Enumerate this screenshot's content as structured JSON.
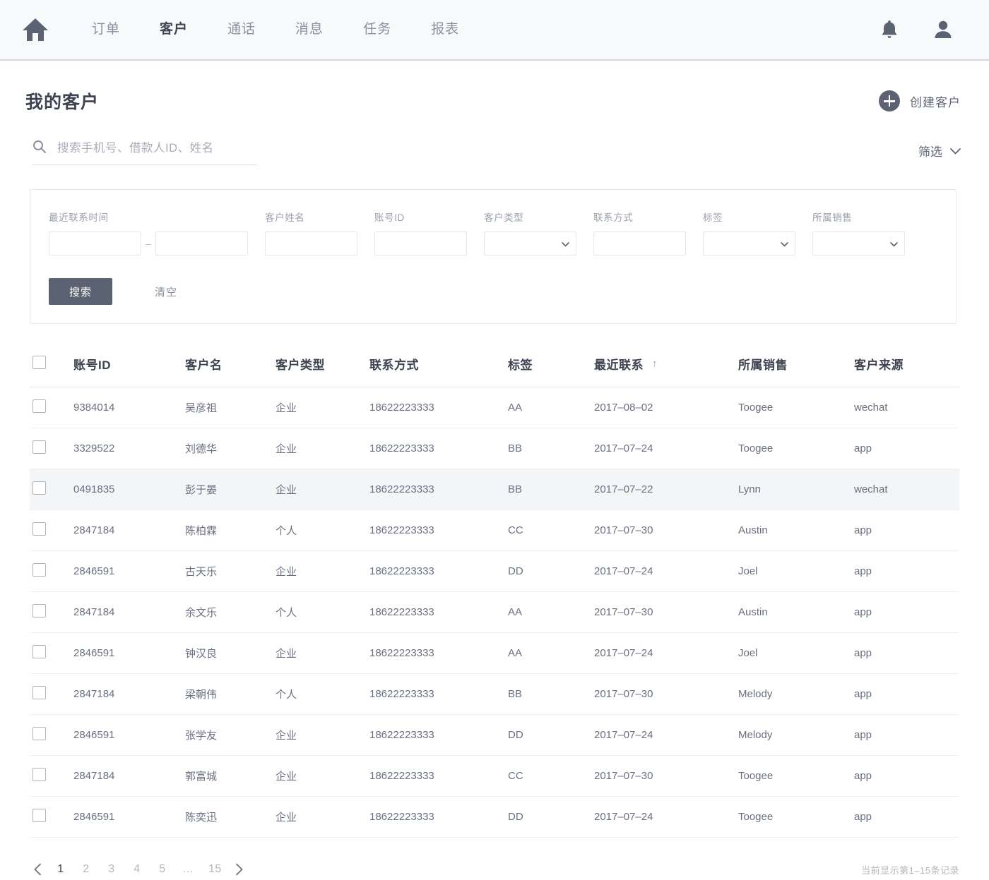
{
  "nav": {
    "home_icon": "home-icon",
    "links": [
      {
        "label": "订单",
        "active": false
      },
      {
        "label": "客户",
        "active": true
      },
      {
        "label": "通话",
        "active": false
      },
      {
        "label": "消息",
        "active": false
      },
      {
        "label": "任务",
        "active": false
      },
      {
        "label": "报表",
        "active": false
      }
    ],
    "bell_icon": "bell-icon",
    "avatar_icon": "user-avatar-icon"
  },
  "header": {
    "title": "我的客户",
    "create_label": "创建客户",
    "create_icon": "plus-circle-icon"
  },
  "search": {
    "icon": "search-icon",
    "value": "",
    "placeholder": "搜索手机号、借款人ID、姓名",
    "filter_toggle_label": "筛选",
    "filter_toggle_icon": "chevron-down-icon"
  },
  "filters": {
    "date_range": {
      "label": "最近联系时间",
      "from": "",
      "to": "",
      "separator": "–"
    },
    "customer_name": {
      "label": "客户姓名",
      "value": ""
    },
    "account_id": {
      "label": "账号ID",
      "value": ""
    },
    "customer_type": {
      "label": "客户类型",
      "value": ""
    },
    "contact": {
      "label": "联系方式",
      "value": ""
    },
    "tag": {
      "label": "标签",
      "value": ""
    },
    "sales_owner": {
      "label": "所属销售",
      "value": ""
    },
    "search_button": "搜索",
    "clear_button": "清空"
  },
  "table": {
    "columns": [
      "账号ID",
      "客户名",
      "客户类型",
      "联系方式",
      "标签",
      "最近联系",
      "所属销售",
      "客户来源"
    ],
    "sort_column": "最近联系",
    "sort_arrow": "↑",
    "rows": [
      {
        "account_id": "9384014",
        "name": "吴彦祖",
        "type": "企业",
        "contact": "18622223333",
        "tag": "AA",
        "last_contact": "2017–08–02",
        "sales": "Toogee",
        "source": "wechat",
        "highlighted": false
      },
      {
        "account_id": "3329522",
        "name": "刘德华",
        "type": "企业",
        "contact": "18622223333",
        "tag": "BB",
        "last_contact": "2017–07–24",
        "sales": "Toogee",
        "source": "app",
        "highlighted": false
      },
      {
        "account_id": "0491835",
        "name": "彭于晏",
        "type": "企业",
        "contact": "18622223333",
        "tag": "BB",
        "last_contact": "2017–07–22",
        "sales": "Lynn",
        "source": "wechat",
        "highlighted": true
      },
      {
        "account_id": "2847184",
        "name": "陈柏霖",
        "type": "个人",
        "contact": "18622223333",
        "tag": "CC",
        "last_contact": "2017–07–30",
        "sales": "Austin",
        "source": "app",
        "highlighted": false
      },
      {
        "account_id": "2846591",
        "name": "古天乐",
        "type": "企业",
        "contact": "18622223333",
        "tag": "DD",
        "last_contact": "2017–07–24",
        "sales": "Joel",
        "source": "app",
        "highlighted": false
      },
      {
        "account_id": "2847184",
        "name": "余文乐",
        "type": "个人",
        "contact": "18622223333",
        "tag": "AA",
        "last_contact": "2017–07–30",
        "sales": "Austin",
        "source": "app",
        "highlighted": false
      },
      {
        "account_id": "2846591",
        "name": "钟汉良",
        "type": "企业",
        "contact": "18622223333",
        "tag": "AA",
        "last_contact": "2017–07–24",
        "sales": "Joel",
        "source": "app",
        "highlighted": false
      },
      {
        "account_id": "2847184",
        "name": "梁朝伟",
        "type": "个人",
        "contact": "18622223333",
        "tag": "BB",
        "last_contact": "2017–07–30",
        "sales": "Melody",
        "source": "app",
        "highlighted": false
      },
      {
        "account_id": "2846591",
        "name": "张学友",
        "type": "企业",
        "contact": "18622223333",
        "tag": "DD",
        "last_contact": "2017–07–24",
        "sales": "Melody",
        "source": "app",
        "highlighted": false
      },
      {
        "account_id": "2847184",
        "name": "郭富城",
        "type": "企业",
        "contact": "18622223333",
        "tag": "CC",
        "last_contact": "2017–07–30",
        "sales": "Toogee",
        "source": "app",
        "highlighted": false
      },
      {
        "account_id": "2846591",
        "name": "陈奕迅",
        "type": "企业",
        "contact": "18622223333",
        "tag": "DD",
        "last_contact": "2017–07–24",
        "sales": "Toogee",
        "source": "app",
        "highlighted": false
      }
    ]
  },
  "pagination": {
    "prev_icon": "chevron-left-icon",
    "next_icon": "chevron-right-icon",
    "pages": [
      "1",
      "2",
      "3",
      "4",
      "5"
    ],
    "ellipsis": "…",
    "last_page": "15",
    "current": "1",
    "info": "当前显示第1–15条记录"
  },
  "colors": {
    "nav_bg": "#f8f9fb",
    "accent": "#5b6372",
    "row_highlight": "#f4f5f6",
    "muted_text": "#9aa0ab"
  }
}
